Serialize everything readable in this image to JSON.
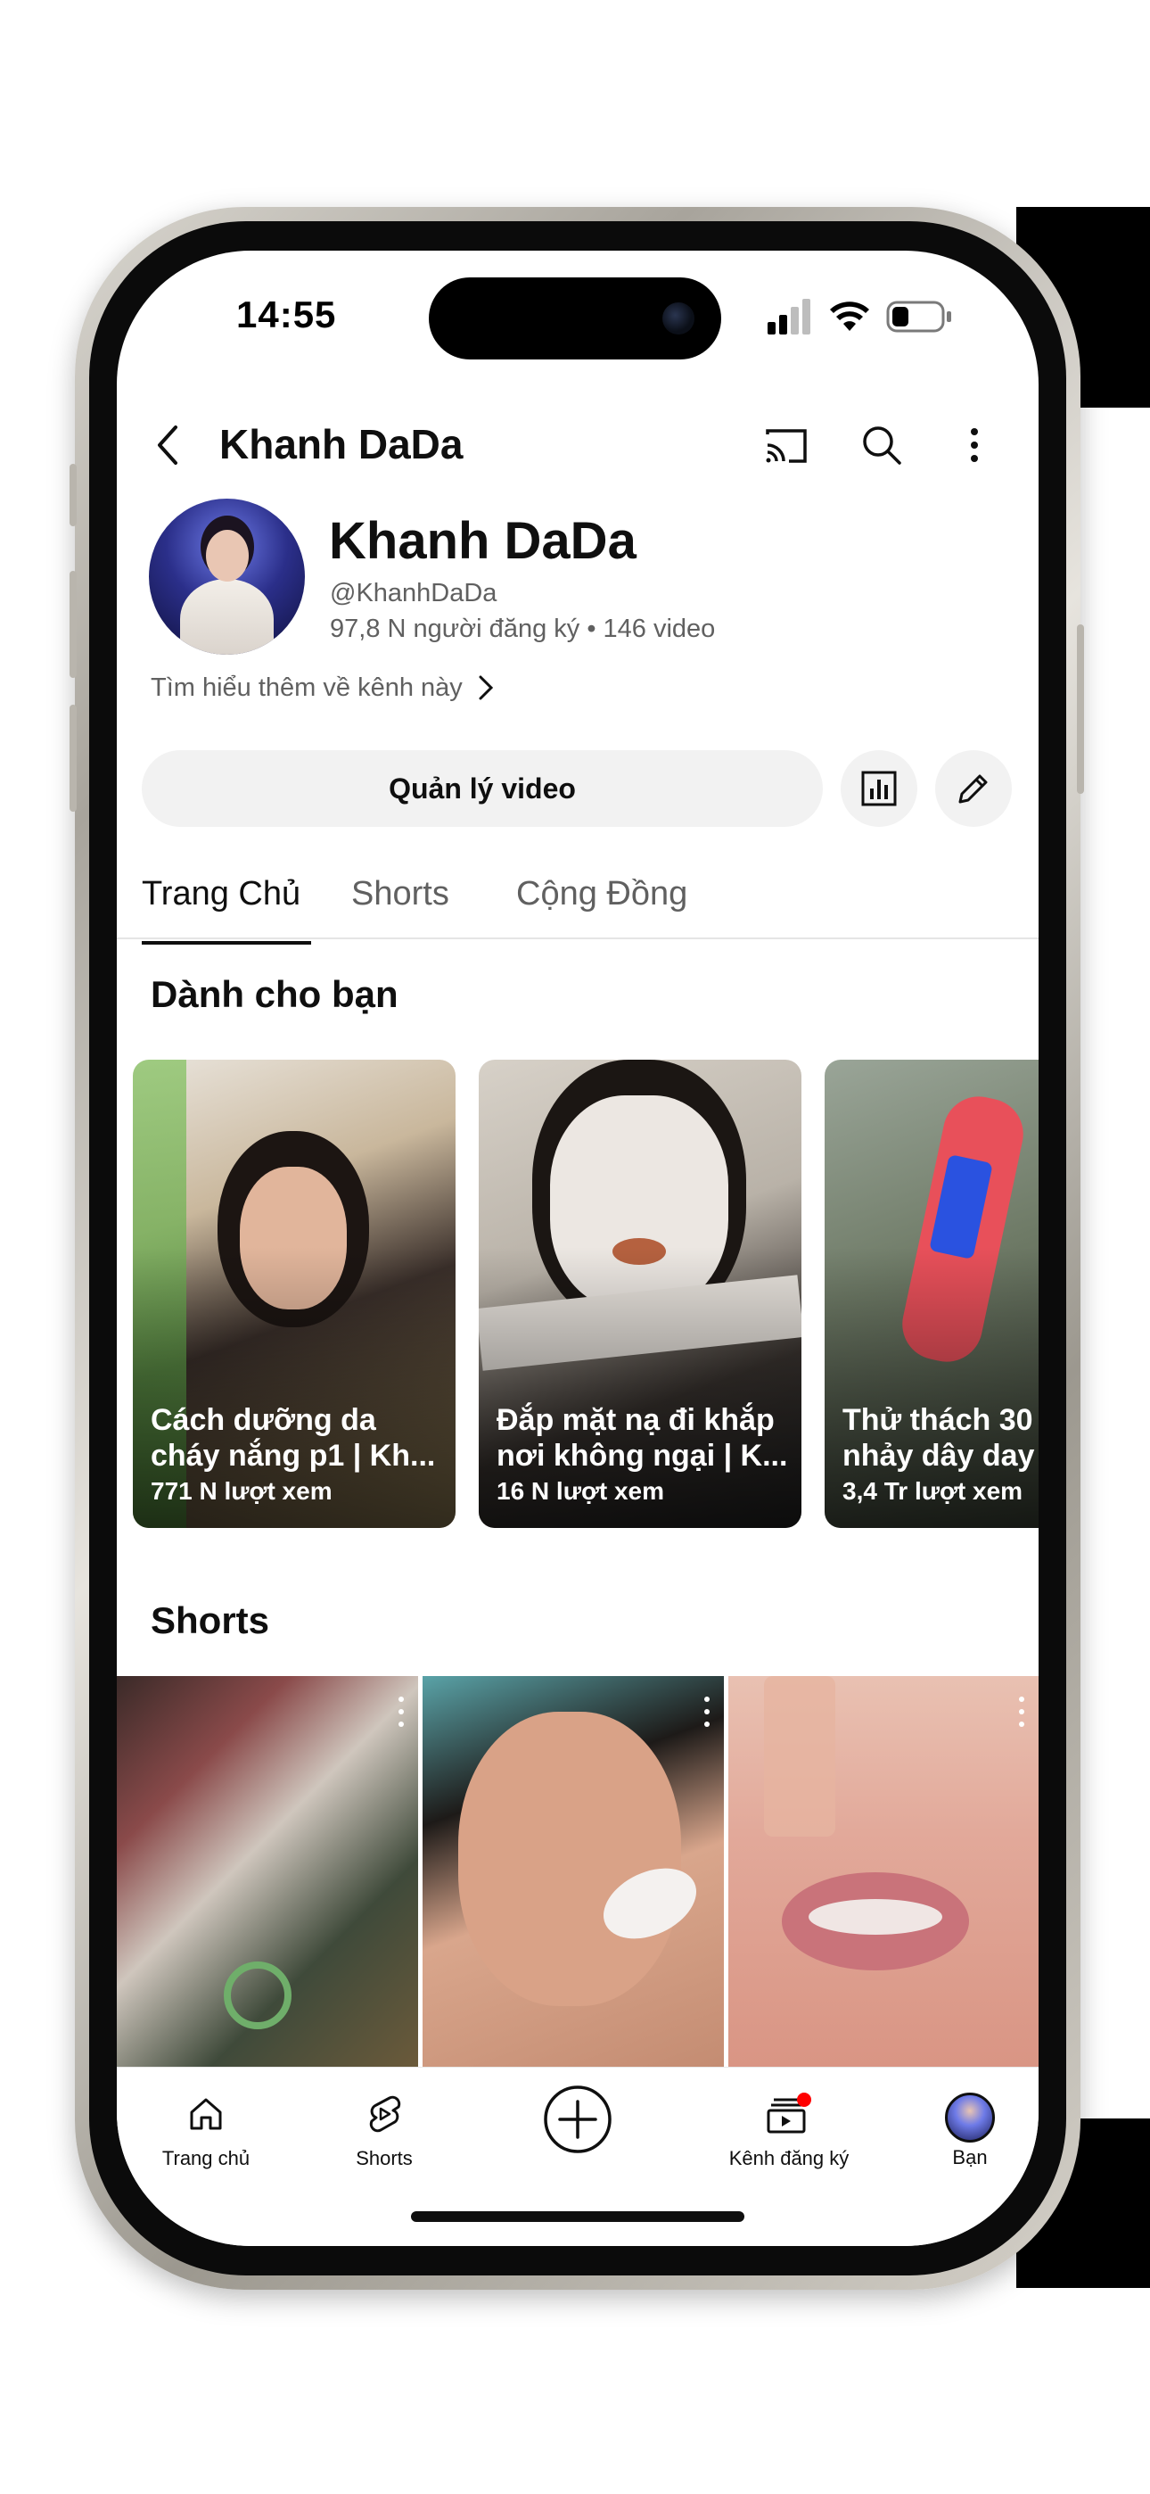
{
  "status": {
    "time": "14:55"
  },
  "header": {
    "title": "Khanh DaDa"
  },
  "channel": {
    "name": "Khanh DaDa",
    "handle": "@KhanhDaDa",
    "stats": "97,8 N người đăng ký • 146 video",
    "learn_more": "Tìm hiểu thêm về kênh này"
  },
  "actions": {
    "manage_videos": "Quản lý video"
  },
  "tabs": [
    {
      "label": "Trang Chủ"
    },
    {
      "label": "Shorts"
    },
    {
      "label": "Cộng Đồng"
    }
  ],
  "for_you": {
    "title": "Dành cho bạn",
    "cards": [
      {
        "title": "Cách dưỡng da\ncháy nắng p1 | Kh...",
        "views": "771 N lượt xem"
      },
      {
        "title": "Đắp mặt nạ đi khắp\nnơi không ngại | K...",
        "views": "16 N lượt xem"
      },
      {
        "title": "Thử thách 30\nnhảy dây day",
        "views": "3,4 Tr lượt xem"
      }
    ]
  },
  "shorts": {
    "title": "Shorts"
  },
  "bottom_nav": [
    {
      "label": "Trang chủ",
      "icon": "home-icon"
    },
    {
      "label": "Shorts",
      "icon": "shorts-icon"
    },
    {
      "label": "",
      "icon": "create-icon"
    },
    {
      "label": "Kênh đăng ký",
      "icon": "subscriptions-icon"
    },
    {
      "label": "Bạn",
      "icon": "profile-avatar"
    }
  ],
  "colors": {
    "text": "#0f0f0f",
    "secondary": "#606060",
    "chip": "#f2f2f2",
    "notification": "#ff0000"
  }
}
